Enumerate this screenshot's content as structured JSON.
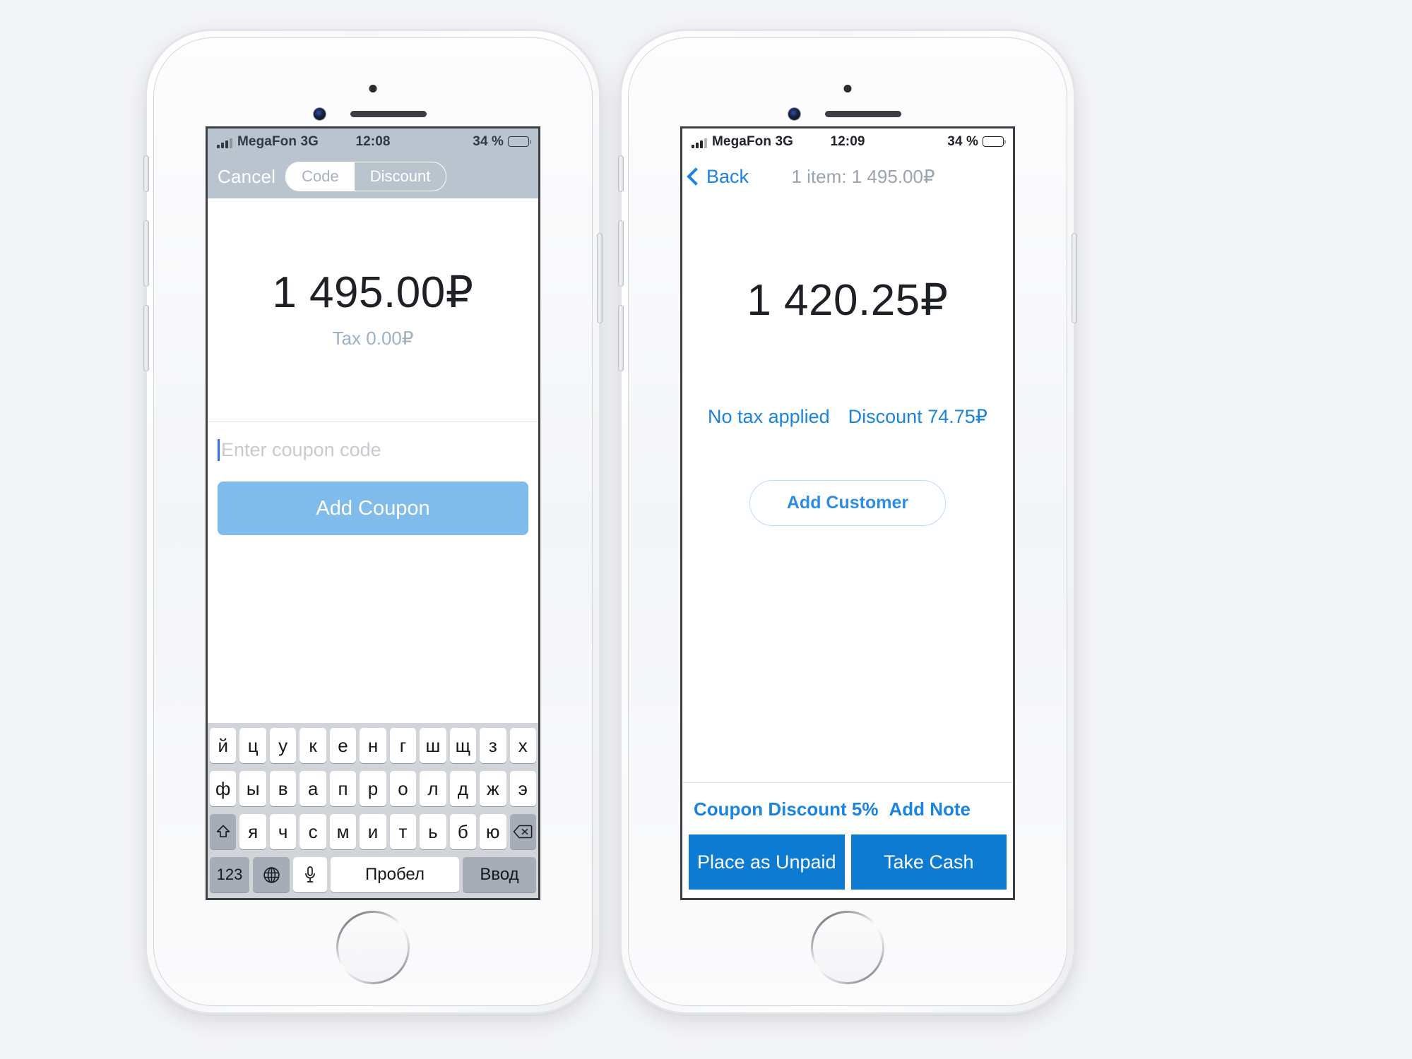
{
  "left_phone": {
    "status_bar": {
      "carrier": "MegaFon 3G",
      "time": "12:08",
      "battery": "34 %"
    },
    "navbar": {
      "cancel_label": "Cancel",
      "segments": [
        {
          "label": "Code",
          "selected": true
        },
        {
          "label": "Discount",
          "selected": false
        }
      ]
    },
    "amount": {
      "total": "1 495.00₽",
      "tax": "Tax 0.00₽"
    },
    "coupon": {
      "placeholder": "Enter coupon code",
      "value": "",
      "add_button_label": "Add Coupon"
    },
    "keyboard": {
      "row1": [
        "й",
        "ц",
        "у",
        "к",
        "е",
        "н",
        "г",
        "ш",
        "щ",
        "з",
        "х"
      ],
      "row2": [
        "ф",
        "ы",
        "в",
        "а",
        "п",
        "р",
        "о",
        "л",
        "д",
        "ж",
        "э"
      ],
      "row3": [
        "я",
        "ч",
        "с",
        "м",
        "и",
        "т",
        "ь",
        "б",
        "ю"
      ],
      "shift_icon": "shift-arrow-up",
      "backspace_icon": "backspace-delete",
      "numbers_key": "123",
      "globe_icon": "globe-language",
      "mic_icon": "microphone",
      "space_label": "Пробел",
      "enter_label": "Ввод"
    }
  },
  "right_phone": {
    "status_bar": {
      "carrier": "MegaFon 3G",
      "time": "12:09",
      "battery": "34 %"
    },
    "navbar": {
      "back_label": "Back",
      "title": "1 item: 1 495.00₽"
    },
    "amount": {
      "total": "1 420.25₽"
    },
    "tax_links": {
      "no_tax": "No tax applied",
      "discount": "Discount 74.75₽"
    },
    "add_customer_label": "Add Customer",
    "bottom_links": {
      "coupon_discount": "Coupon Discount 5%",
      "add_note": "Add Note"
    },
    "actions": {
      "place_unpaid": "Place as Unpaid",
      "take_cash": "Take Cash"
    }
  },
  "colors": {
    "accent_blue": "#0c7bd1",
    "link_blue": "#1a84e0",
    "disabled_blue": "#7fbcec",
    "navbar_tint": "#b9c4ce",
    "keyboard_bg": "#d1d5da"
  }
}
